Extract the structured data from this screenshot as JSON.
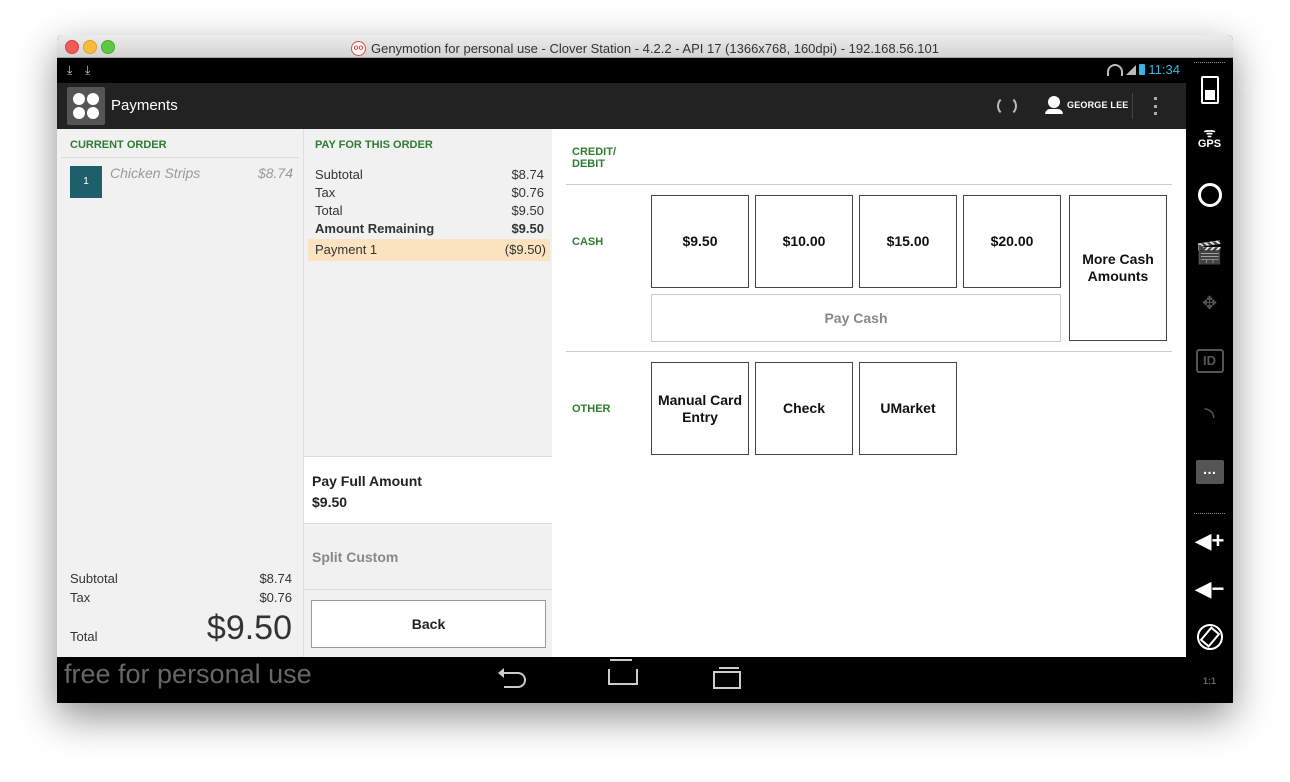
{
  "window": {
    "title": "Genymotion for personal use - Clover Station - 4.2.2 - API 17 (1366x768, 160dpi) - 192.168.56.101"
  },
  "statusbar": {
    "time": "11:34"
  },
  "actionbar": {
    "title": "Payments",
    "user_name": "GEORGE LEE"
  },
  "current_order": {
    "heading": "CURRENT ORDER",
    "items": [
      {
        "qty": "1",
        "name": "Chicken Strips",
        "price": "$8.74"
      }
    ],
    "subtotal_label": "Subtotal",
    "subtotal_value": "$8.74",
    "tax_label": "Tax",
    "tax_value": "$0.76",
    "total_label": "Total",
    "total_value": "$9.50"
  },
  "pay_for_order": {
    "heading": "PAY FOR THIS ORDER",
    "rows": [
      {
        "label": "Subtotal",
        "value": "$8.74"
      },
      {
        "label": "Tax",
        "value": "$0.76"
      },
      {
        "label": "Total",
        "value": "$9.50"
      },
      {
        "label": "Amount Remaining",
        "value": "$9.50"
      },
      {
        "label": "Payment 1",
        "value": "($9.50)"
      }
    ],
    "pay_full_label": "Pay Full Amount",
    "pay_full_amount": "$9.50",
    "split_custom": "Split Custom",
    "back": "Back"
  },
  "methods": {
    "credit_debit": "CREDIT/\nDEBIT",
    "cash": "CASH",
    "cash_amounts": [
      "$9.50",
      "$10.00",
      "$15.00",
      "$20.00"
    ],
    "more_cash": "More Cash Amounts",
    "pay_cash": "Pay Cash",
    "other": "OTHER",
    "other_options": [
      "Manual Card Entry",
      "Check",
      "UMarket"
    ]
  },
  "navbar": {
    "watermark": "free for personal use"
  },
  "sidebar": {
    "gps": "GPS",
    "id": "ID",
    "scale": "1:1"
  },
  "colors": {
    "accent_green": "#2e7d32",
    "qty_badge": "#1f5f6c",
    "payment_highlight": "#fce3c0",
    "status_blue": "#33b5e5"
  }
}
